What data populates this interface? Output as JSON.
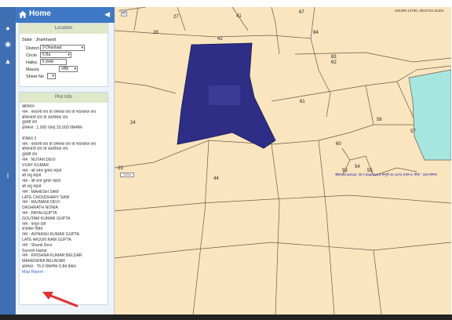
{
  "header": {
    "title": "Home",
    "collapse_icon": "chevron-left-icon"
  },
  "location": {
    "card_title": "Location",
    "state_label": "State : Jharkhand",
    "district_label": "District",
    "district_value": "9 Dhanbad",
    "circle_label": "Circle",
    "circle_value": "6 Ba",
    "halka_label": "Halka",
    "halka_value": "5 हल्का",
    "mauza_label": "Mauza",
    "mauza_value": "जोड़ि",
    "sheet_label": "Sheet No"
  },
  "plot_info": {
    "card_title": "Plot Info",
    "lines": [
      "खतियान",
      "नाम : बरवानी राय वो रामेश्वर राय वो मदनलाल राय",
      "सीमानाती राय वो कालीचक राय",
      "तुलसी राय",
      "क्षेत्रफल : 1.000 एकड़ 33.000 डिसमील",
      "",
      "रजिस्टर 2",
      "नाम : बरवानी राय वो रामेश्वर राय वो मदनलाल राय",
      "सीमानाती राय वो कालीचक राय",
      "तुलसी राय",
      "नाम : NUTAN DEVI",
      "VIJAY KUMAR",
      "नाम : श्री रमेश कुमार महतो",
      "श्री शनु महतो",
      "नाम : श्री राज कुमार महतो",
      "श्री शनु महतो",
      "नाम : MAHESH SAW",
      "LATE CHOUDHARY SAW",
      "नाम : RAJMANI DEVI",
      "DASHRATH NONIA",
      "नाम : PAYALGUPTA",
      "GOUTAM KUMAR GUPTA",
      "नाम : कपूरा देवी",
      "राजकेश पंडित",
      "नाम : AVINASH KUMAR GUPTA",
      "LATE ARJUN RAM GUPTA",
      "नाम : Shanti Devi",
      "Suresh Hahat",
      "नाम : KRISHNA KUMAR BELDAR",
      "MAHENDRA BELADAR",
      "क्षेत्रफल : 76.0 डिसमील 6.84 हेक्टर"
    ],
    "map_report": "Map Report"
  },
  "map": {
    "coordinates": "426495.14700, 2624723.11464",
    "scale_label": "100m",
    "info_line": "खेसरा Dhanbad, 98 0 Baghmara सम्पूर्ण 46 Jorhi अंचल 6, मौजा : 348 सम्मान",
    "plot_numbers": [
      "27",
      "41",
      "67",
      "28",
      "84",
      "42",
      "83",
      "62",
      "24",
      "61",
      "56",
      "57",
      "60",
      "23",
      "54",
      "55",
      "53",
      "44"
    ],
    "selected_plot_color": "#2e2e87",
    "adjacent_plot_color": "#a6e6df",
    "background_color": "#fae5bf"
  }
}
